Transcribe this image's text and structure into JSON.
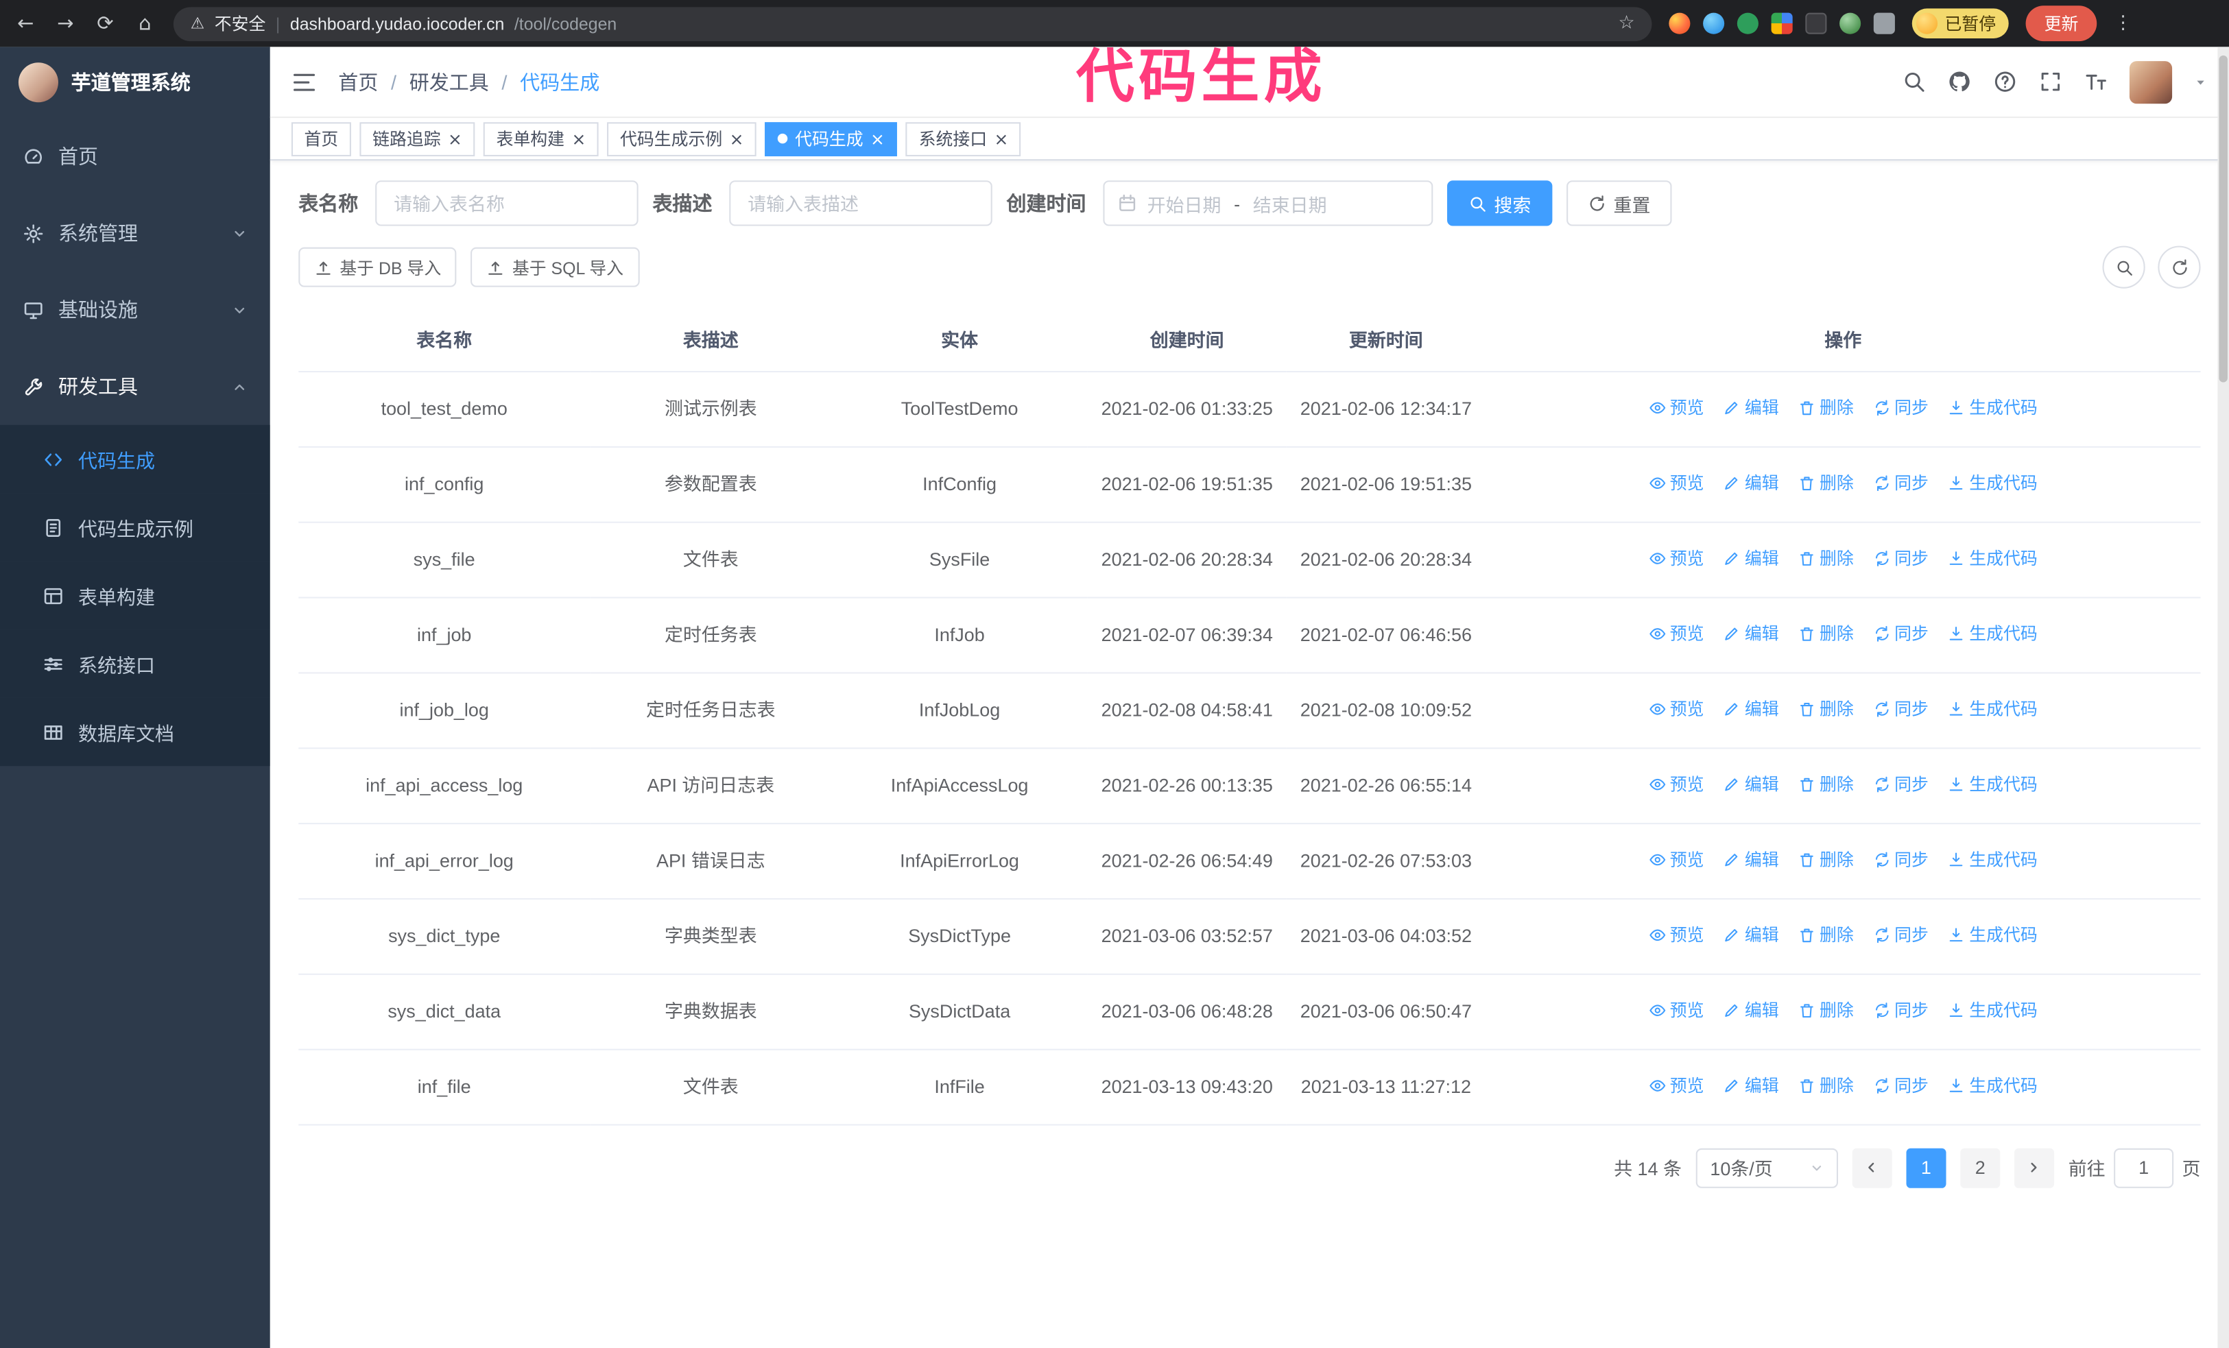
{
  "colors": {
    "primary": "#409eff",
    "chrome_bg": "#202124",
    "sidebar_bg": "#2d3a4b",
    "submenu_bg": "#1f2d3d",
    "tag_active_bg": "#409eff",
    "update_button_bg": "#e25a4b",
    "paused_badge_bg": "#f3d96d",
    "annotation": "#ff3b7c"
  },
  "browser": {
    "security_label": "不安全",
    "url_host": "dashboard.yudao.iocoder.cn",
    "url_path": "/tool/codegen",
    "profile_badge": "已暂停",
    "update_button": "更新"
  },
  "annotation": {
    "text": "代码生成"
  },
  "sidebar": {
    "logo_title": "芋道管理系统",
    "menu": [
      {
        "label": "首页",
        "icon": "dashboard-icon"
      },
      {
        "label": "系统管理",
        "icon": "gear-icon",
        "chevron_down": true
      },
      {
        "label": "基础设施",
        "icon": "monitor-icon",
        "chevron_down": true
      },
      {
        "label": "研发工具",
        "icon": "tool-icon",
        "chevron_up": true,
        "expanded": true
      },
      {
        "label": "代码生成",
        "icon": "code-icon",
        "sub": true,
        "active": true
      },
      {
        "label": "代码生成示例",
        "icon": "example-icon",
        "sub": true
      },
      {
        "label": "表单构建",
        "icon": "form-icon",
        "sub": true
      },
      {
        "label": "系统接口",
        "icon": "api-icon",
        "sub": true
      },
      {
        "label": "数据库文档",
        "icon": "database-icon",
        "sub": true
      }
    ]
  },
  "header": {
    "breadcrumb_separator": "/",
    "breadcrumb": [
      {
        "label": "首页"
      },
      {
        "label": "研发工具"
      },
      {
        "label": "代码生成",
        "current": true
      }
    ]
  },
  "tabs": [
    {
      "label": "首页"
    },
    {
      "label": "链路追踪",
      "closable": true
    },
    {
      "label": "表单构建",
      "closable": true
    },
    {
      "label": "代码生成示例",
      "closable": true
    },
    {
      "label": "代码生成",
      "closable": true,
      "active": true
    },
    {
      "label": "系统接口",
      "closable": true
    }
  ],
  "filters": {
    "table_name_label": "表名称",
    "table_name_placeholder": "请输入表名称",
    "table_desc_label": "表描述",
    "table_desc_placeholder": "请输入表描述",
    "create_time_label": "创建时间",
    "date_start_placeholder": "开始日期",
    "date_separator": "-",
    "date_end_placeholder": "结束日期",
    "search_button": "搜索",
    "reset_button": "重置"
  },
  "toolbar": {
    "db_import_button": "基于 DB 导入",
    "sql_import_button": "基于 SQL 导入"
  },
  "table": {
    "columns": [
      "表名称",
      "表描述",
      "实体",
      "创建时间",
      "更新时间",
      "操作"
    ],
    "row_actions": [
      {
        "label": "预览",
        "icon": "eye-icon"
      },
      {
        "label": "编辑",
        "icon": "edit-icon"
      },
      {
        "label": "删除",
        "icon": "delete-icon"
      },
      {
        "label": "同步",
        "icon": "sync-icon"
      },
      {
        "label": "生成代码",
        "icon": "download-icon"
      }
    ],
    "rows": [
      {
        "name": "tool_test_demo",
        "desc": "测试示例表",
        "entity": "ToolTestDemo",
        "created": "2021-02-06 01:33:25",
        "updated": "2021-02-06 12:34:17"
      },
      {
        "name": "inf_config",
        "desc": "参数配置表",
        "entity": "InfConfig",
        "created": "2021-02-06 19:51:35",
        "updated": "2021-02-06 19:51:35"
      },
      {
        "name": "sys_file",
        "desc": "文件表",
        "entity": "SysFile",
        "created": "2021-02-06 20:28:34",
        "updated": "2021-02-06 20:28:34"
      },
      {
        "name": "inf_job",
        "desc": "定时任务表",
        "entity": "InfJob",
        "created": "2021-02-07 06:39:34",
        "updated": "2021-02-07 06:46:56"
      },
      {
        "name": "inf_job_log",
        "desc": "定时任务日志表",
        "entity": "InfJobLog",
        "created": "2021-02-08 04:58:41",
        "updated": "2021-02-08 10:09:52"
      },
      {
        "name": "inf_api_access_log",
        "desc": "API 访问日志表",
        "entity": "InfApiAccessLog",
        "created": "2021-02-26 00:13:35",
        "updated": "2021-02-26 06:55:14"
      },
      {
        "name": "inf_api_error_log",
        "desc": "API 错误日志",
        "entity": "InfApiErrorLog",
        "created": "2021-02-26 06:54:49",
        "updated": "2021-02-26 07:53:03"
      },
      {
        "name": "sys_dict_type",
        "desc": "字典类型表",
        "entity": "SysDictType",
        "created": "2021-03-06 03:52:57",
        "updated": "2021-03-06 04:03:52"
      },
      {
        "name": "sys_dict_data",
        "desc": "字典数据表",
        "entity": "SysDictData",
        "created": "2021-03-06 06:48:28",
        "updated": "2021-03-06 06:50:47"
      },
      {
        "name": "inf_file",
        "desc": "文件表",
        "entity": "InfFile",
        "created": "2021-03-13 09:43:20",
        "updated": "2021-03-13 11:27:12"
      }
    ]
  },
  "pagination": {
    "total": "共 14 条",
    "page_size": "10条/页",
    "pages": [
      {
        "label": "1",
        "active": true
      },
      {
        "label": "2"
      }
    ],
    "goto_label": "前往",
    "goto_value": "1",
    "goto_suffix": "页"
  }
}
